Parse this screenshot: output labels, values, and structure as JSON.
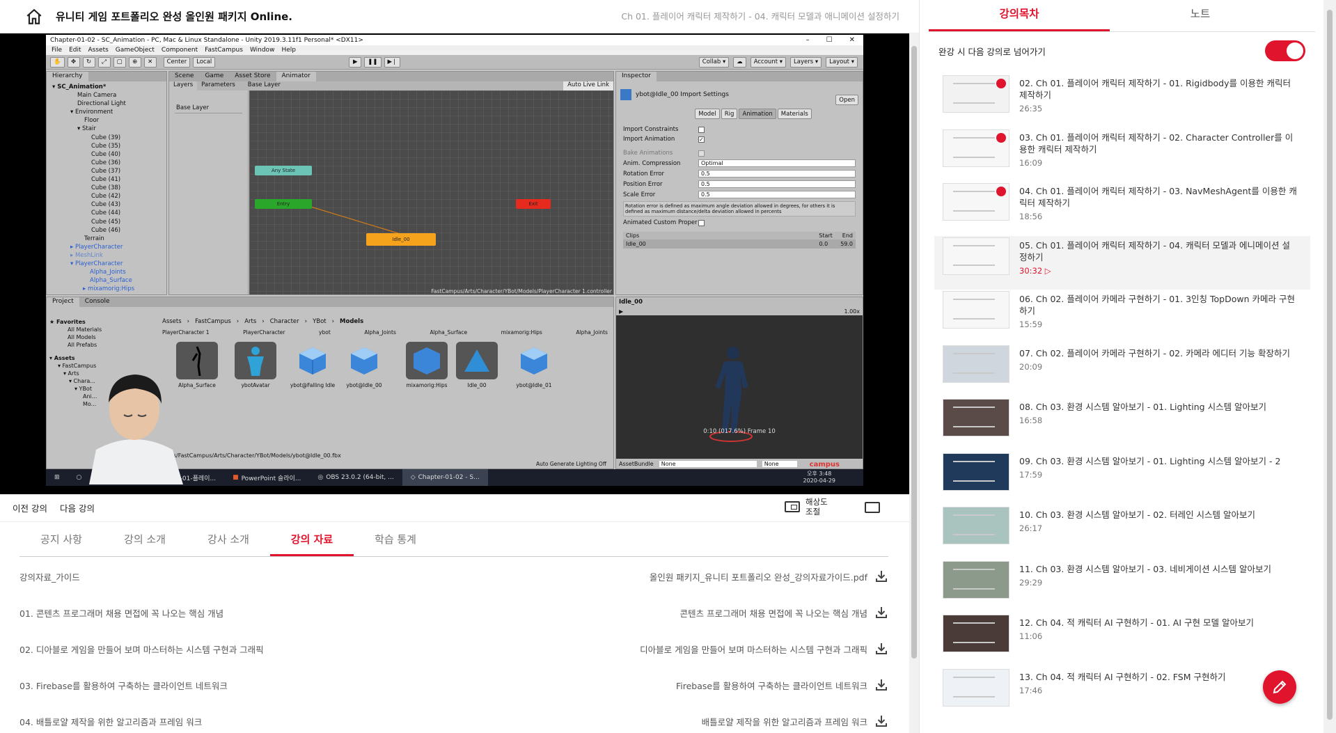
{
  "header": {
    "course_title": "유니티 게임 포트폴리오 완성 올인원 패키지 Online.",
    "lecture_crumb": "Ch 01. 플레이어 캐릭터 제작하기 - 04. 캐릭터 모델과 애니메이션 설정하기"
  },
  "video": {
    "unity_window_title": "Chapter-01-02 - SC_Animation - PC, Mac & Linux Standalone - Unity 2019.3.11f1 Personal* <DX11>",
    "menu": [
      "File",
      "Edit",
      "Assets",
      "GameObject",
      "Component",
      "FastCampus",
      "Window",
      "Help"
    ],
    "toolbar_center": "Center",
    "toolbar_local": "Local",
    "toolbar_right": [
      "Collab ▾",
      "Account ▾",
      "Layers ▾",
      "Layout ▾"
    ],
    "hierarchy_tab": "Hierarchy",
    "hierarchy_items": [
      "▾ SC_Animation*",
      "Main Camera",
      "Directional Light",
      "▾ Environment",
      "Floor",
      "▾ Stair",
      "Cube (39)",
      "Cube (35)",
      "Cube (40)",
      "Cube (36)",
      "Cube (37)",
      "Cube (41)",
      "Cube (38)",
      "Cube (42)",
      "Cube (43)",
      "Cube (44)",
      "Cube (45)",
      "Cube (46)",
      "Terrain",
      "▸ PlayerCharacter",
      "▸ MeshLink",
      "▾ PlayerCharacter",
      "Alpha_Joints",
      "Alpha_Surface",
      "▸ mixamorig:Hips"
    ],
    "center_tabs": [
      "Scene",
      "Game",
      "Asset Store",
      "Animator"
    ],
    "animator_subtabs": [
      "Layers",
      "Parameters"
    ],
    "base_layer": "Base Layer",
    "auto_live_link": "Auto Live Link",
    "node_any_state": "Any State",
    "node_entry": "Entry",
    "node_idle": "Idle_00",
    "node_exit": "Exit",
    "controller_path": "FastCampus/Arts/Character/YBot/Models/PlayerCharacter 1.controller",
    "inspector_tab": "Inspector",
    "inspector_title": "ybot@Idle_00 Import Settings",
    "inspector_open": "Open",
    "inspector_tabs": [
      "Model",
      "Rig",
      "Animation",
      "Materials"
    ],
    "import_constraints": "Import Constraints",
    "import_animation": "Import Animation",
    "bake_animations": "Bake Animations",
    "fields": [
      {
        "label": "Anim. Compression",
        "value": "Optimal"
      },
      {
        "label": "Rotation Error",
        "value": "0.5"
      },
      {
        "label": "Position Error",
        "value": "0.5"
      },
      {
        "label": "Scale Error",
        "value": "0.5"
      }
    ],
    "error_note": "Rotation error is defined as maximum angle deviation allowed in degrees, for others it is defined as maximum distance/delta deviation allowed in percents",
    "animated_custom": "Animated Custom Proper",
    "clips_header": "Clips",
    "clips_start": "Start",
    "clips_end": "End",
    "clip_name": "Idle_00",
    "clip_start_val": "0.0",
    "clip_end_val": "59.0",
    "preview_name": "Idle_00",
    "preview_speed": "1.00x",
    "preview_frame": "0:10 (017.6%) Frame 10",
    "asset_bundle": "AssetBundle",
    "asset_bundle_val": "None",
    "asset_bundle_val2": "None",
    "project_tabs": [
      "Project",
      "Console"
    ],
    "favorites": [
      "★ Favorites",
      "All Materials",
      "All Models",
      "All Prefabs"
    ],
    "assets_tree": [
      "▾ Assets",
      "▾ FastCampus",
      "▾ Arts",
      "▾ Chara...",
      "▾ YBot",
      "Ani...",
      "Mo..."
    ],
    "breadcrumb": [
      "Assets",
      "FastCampus",
      "Arts",
      "Character",
      "YBot",
      "Models"
    ],
    "asset_top_labels": [
      "PlayerCharacter 1",
      "PlayerCharacter",
      "ybot",
      "Alpha_Joints",
      "Alpha_Surface",
      "mixamorig:Hips",
      "Alpha_Joints"
    ],
    "assets": [
      "Alpha_Surface",
      "ybotAvatar",
      "ybot@Falling Idle",
      "ybot@Idle_00",
      "mixamorig:Hips",
      "Idle_00",
      "ybot@Idle_01"
    ],
    "asset_path": "Assets/FastCampus/Arts/Character/YBot/Models/ybot@Idle_00.fbx",
    "auto_generate": "Auto Generate Lighting Off",
    "taskbar_items": [
      "Chapter-01-플레이...",
      "PowerPoint 슬라이...",
      "OBS 23.0.2 (64-bit, ...",
      "Chapter-01-02 - S..."
    ],
    "clock_time": "오후 3:48",
    "clock_date": "2020-04-29",
    "brand_text": "campus"
  },
  "player": {
    "prev": "이전 강의",
    "next": "다음 강의",
    "resolution": "해상도\n조절"
  },
  "tabs": [
    "공지 사항",
    "강의 소개",
    "강사 소개",
    "강의 자료",
    "학습 통계"
  ],
  "materials": [
    {
      "left": "강의자료_가이드",
      "right": "올인원 패키지_유니티 포트폴리오 완성_강의자료가이드.pdf"
    },
    {
      "left": "01. 콘텐츠 프로그래머 채용 면접에 꼭 나오는 핵심 개념",
      "right": "콘텐츠 프로그래머 채용 면접에 꼭 나오는 핵심 개념"
    },
    {
      "left": "02. 디아블로 게임을 만들어 보며 마스터하는 시스템 구현과 그래픽",
      "right": "디아블로 게임을 만들어 보며 마스터하는 시스템 구현과 그래픽"
    },
    {
      "left": "03. Firebase를 활용하여 구축하는 클라이언트 네트워크",
      "right": "Firebase를 활용하여 구축하는 클라이언트 네트워크"
    },
    {
      "left": "04. 배틀로얄 제작을 위한 알고리즘과 프레임 워크",
      "right": "배틀로얄 제작을 위한 알고리즘과 프레임 워크"
    }
  ],
  "sidebar": {
    "tabs": [
      "강의목차",
      "노트"
    ],
    "autoplay_label": "완강 시 다음 강의로 넘어가기",
    "lectures": [
      {
        "title": "02. Ch 01. 플레이어 캐릭터 제작하기 - 01. Rigidbody를 이용한 캐릭터 제작하기",
        "time": "26:35",
        "done": true
      },
      {
        "title": "03. Ch 01. 플레이어 캐릭터 제작하기 - 02. Character Controller를 이용한 캐릭터 제작하기",
        "time": "16:09",
        "done": true
      },
      {
        "title": "04. Ch 01. 플레이어 캐릭터 제작하기 - 03. NavMeshAgent를 이용한 캐릭터 제작하기",
        "time": "18:56",
        "done": true
      },
      {
        "title": "05. Ch 01. 플레이어 캐릭터 제작하기 - 04. 캐릭터 모델과 에니메이션 설정하기",
        "time": "30:32",
        "done": false,
        "current": true
      },
      {
        "title": "06. Ch 02. 플레이어 카메라 구현하기 - 01. 3인칭 TopDown 카메라 구현하기",
        "time": "15:59",
        "done": false
      },
      {
        "title": "07. Ch 02. 플레이어 카메라 구현하기 - 02. 카메라 에디터 기능 확장하기",
        "time": "20:09",
        "done": false
      },
      {
        "title": "08. Ch 03. 환경 시스템 알아보기 - 01. Lighting 시스템 알아보기",
        "time": "16:58",
        "done": false
      },
      {
        "title": "09. Ch 03. 환경 시스템 알아보기 - 01. Lighting 시스템 알아보기 - 2",
        "time": "17:59",
        "done": false
      },
      {
        "title": "10. Ch 03. 환경 시스템 알아보기 - 02. 터레인 시스템 알아보기",
        "time": "26:17",
        "done": false
      },
      {
        "title": "11. Ch 03. 환경 시스템 알아보기 - 03. 네비게이션 시스템 알아보기",
        "time": "29:29",
        "done": false
      },
      {
        "title": "12. Ch 04. 적 캐릭터 AI 구현하기 - 01. AI 구현 모델 알아보기",
        "time": "11:06",
        "done": false
      },
      {
        "title": "13. Ch 04. 적 캐릭터 AI 구현하기 - 02. FSM 구현하기",
        "time": "17:46",
        "done": false
      }
    ]
  },
  "colors": {
    "accent": "#e0142d"
  }
}
